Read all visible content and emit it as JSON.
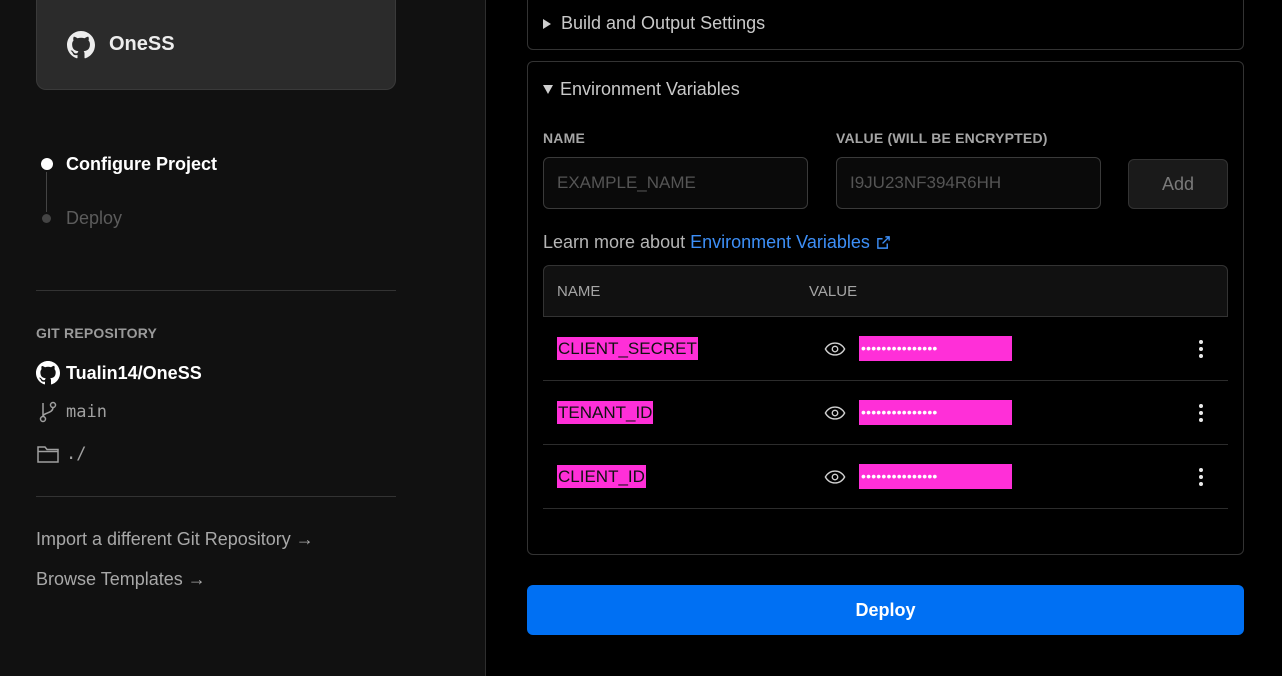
{
  "sidebar": {
    "project_name": "OneSS",
    "steps": [
      {
        "label": "Configure Project",
        "state": "active"
      },
      {
        "label": "Deploy",
        "state": "inactive"
      }
    ],
    "git": {
      "heading": "GIT REPOSITORY",
      "repo": "Tualin14/OneSS",
      "branch": "main",
      "root_dir": "./"
    },
    "links": {
      "import": "Import a different Git Repository →",
      "templates": "Browse Templates →"
    }
  },
  "build_settings": {
    "label": "Build and Output Settings"
  },
  "env": {
    "label": "Environment Variables",
    "name_label": "NAME",
    "value_label": "VALUE (WILL BE ENCRYPTED)",
    "name_placeholder": "EXAMPLE_NAME",
    "value_placeholder": "I9JU23NF394R6HH",
    "add_label": "Add",
    "learn_prefix": "Learn more about",
    "learn_link": "Environment Variables",
    "table": {
      "columns": [
        "NAME",
        "VALUE"
      ],
      "rows": [
        {
          "key": "CLIENT_SECRET",
          "value": "•••••••••••••••"
        },
        {
          "key": "TENANT_ID",
          "value": "•••••••••••••••"
        },
        {
          "key": "CLIENT_ID",
          "value": "•••••••••••••••"
        }
      ]
    }
  },
  "deploy_label": "Deploy",
  "colors": {
    "accent": "#0070f3",
    "highlight": "#ff2fd8",
    "link": "#3d8ff7"
  }
}
